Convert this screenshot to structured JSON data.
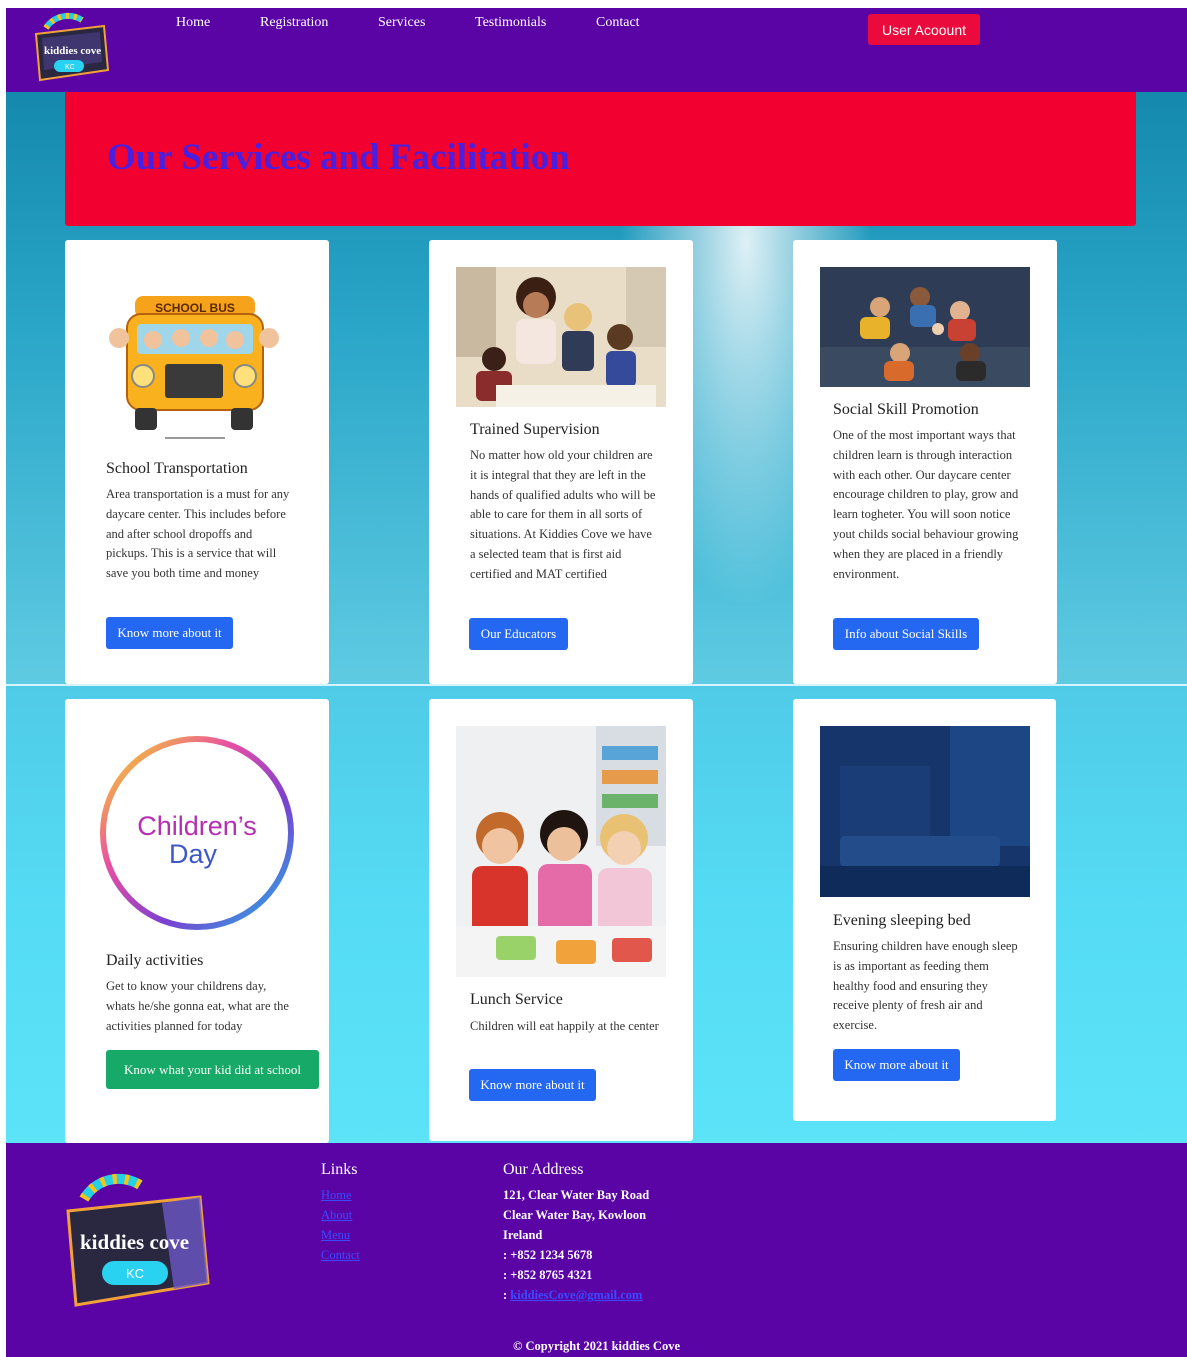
{
  "nav": {
    "logo_text": "kiddies cove",
    "logo_badge": "KC",
    "links": [
      "Home",
      "Registration",
      "Services",
      "Testimonials",
      "Contact"
    ],
    "user_button": "User Acoount"
  },
  "hero": {
    "title": "Our Services and Facilitation"
  },
  "cards": [
    {
      "title": "School Transportation",
      "image_text": "SCHOOL BUS",
      "text": "Area transportation is a must for any daycare center. This includes before and after school dropoffs and pickups. This is a service that will save you both time and money",
      "button": "Know more about it"
    },
    {
      "title": "Trained Supervision",
      "text": "No matter how old your children are it is integral that they are left in the hands of qualified adults who will be able to care for them in all sorts of situations. At Kiddies Cove we have a selected team that is first aid certified and MAT certified",
      "button": "Our Educators"
    },
    {
      "title": "Social Skill Promotion",
      "text": "One of the most important ways that children learn is through interaction with each other. Our daycare center encourage children to play, grow and learn togheter. You will soon notice yout childs social behaviour growing when they are placed in a friendly environment.",
      "button": "Info about Social Skills"
    },
    {
      "title": "Daily activities",
      "image_line1": "Children’s",
      "image_line2": "Day",
      "text": "Get to know your childrens day, whats he/she gonna eat, what are the activities planned for today",
      "button": "Know what your kid did at school"
    },
    {
      "title": "Lunch Service",
      "text": "Children will eat happily at the center",
      "button": "Know more about it"
    },
    {
      "title": "Evening sleeping bed",
      "text": "Ensuring children have enough sleep is as important as feeding them healthy food and ensuring they receive plenty of fresh air and exercise.",
      "button": "Know more about it"
    }
  ],
  "footer": {
    "logo_text": "kiddies cove",
    "logo_badge": "KC",
    "links_heading": "Links",
    "links": [
      "Home",
      "About",
      "Menu",
      "Contact"
    ],
    "address_heading": "Our Address",
    "address_lines": [
      "121, Clear Water Bay Road",
      "Clear Water Bay, Kowloon",
      "Ireland"
    ],
    "phone1": ": +852 1234 5678",
    "phone2": ": +852 8765 4321",
    "email_prefix": ": ",
    "email": "kiddiesCove@gmail.com",
    "copyright": "© Copyright 2021 kiddies Cove"
  }
}
